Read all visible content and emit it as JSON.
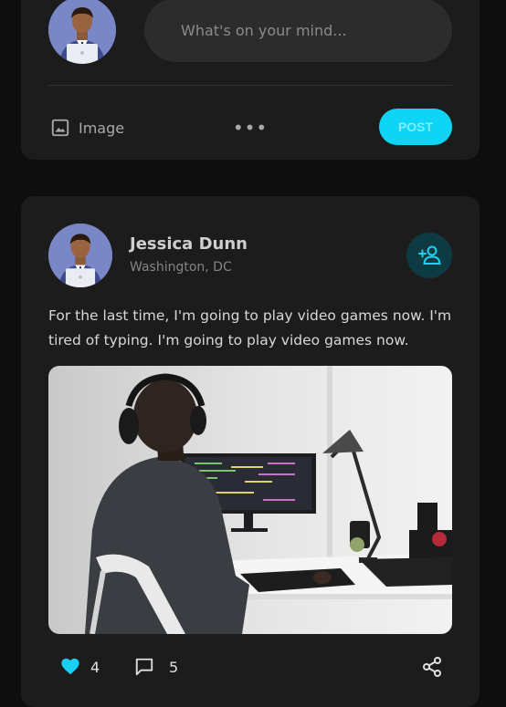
{
  "composer": {
    "placeholder": "What's on your mind...",
    "image_label": "Image",
    "more_label": "•••",
    "post_label": "POST"
  },
  "post": {
    "author": "Jessica Dunn",
    "location": "Washington, DC",
    "text": "For the last time, I'm going to play video games now. I'm tired of typing. I'm going to play video games now.",
    "likes": "4",
    "comments": "5"
  },
  "colors": {
    "accent": "#10d4f5",
    "card": "#1c1c1c",
    "background": "#0e0e0e"
  },
  "icons": [
    "image-icon",
    "more-icon",
    "add-friend-icon",
    "heart-icon",
    "comment-icon",
    "share-icon"
  ]
}
